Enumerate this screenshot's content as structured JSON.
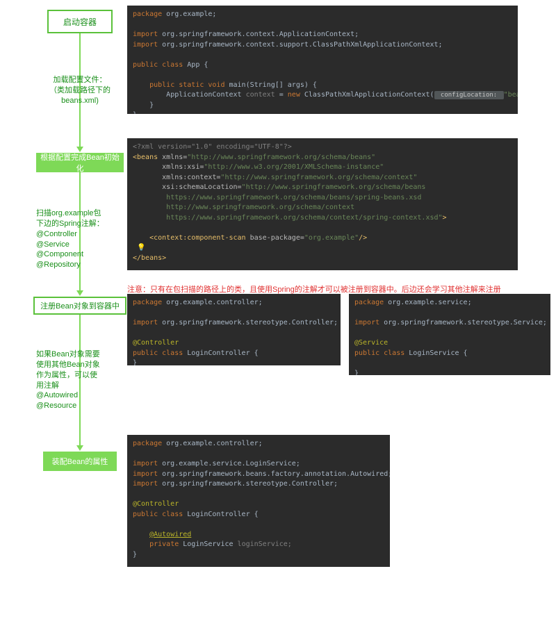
{
  "flow": {
    "box1": "启动容器",
    "box2": "根据配置完成Bean初始化",
    "box3": "注册Bean对象到容器中",
    "box4": "装配Bean的属性"
  },
  "notes": {
    "n1": "加载配置文件：\n（类加载路径下的\nbeans.xml)",
    "n2": "扫描org.example包\n下边的Spring注解：\n@Controller\n@Service\n@Component\n@Repository",
    "n3": "如果Bean对象需要\n使用其他Bean对象\n作为属性，可以使\n用注解\n@Autowired\n@Resource"
  },
  "warn": "注意：只有在包扫描的路径上的类，且使用Spring的注解才可以被注册到容器中。后边还会学习其他注解来注册",
  "code1": {
    "l1_pkg": "package",
    "l1_txt": " org.example;",
    "l3_imp": "import",
    "l3_txt": " org.springframework.context.ApplicationContext;",
    "l4_imp": "import",
    "l4_txt": " org.springframework.context.support.ClassPathXmlApplicationContext;",
    "l6a": "public class ",
    "l6b": "App {",
    "l8a": "public static void ",
    "l8b": "main(String[] args) {",
    "l9a": "ApplicationContext ",
    "l9var": "context",
    "l9b": " = ",
    "l9new": "new",
    "l9c": " ClassPathXmlApplicationContext(",
    "l9hint": " configLocation: ",
    "l9str": "\"beans.xml\"",
    "l9d": ");",
    "l10": "    }",
    "l11": "}"
  },
  "code2": {
    "l1": "<?xml version=\"1.0\" encoding=\"UTF-8\"?>",
    "l2a": "<beans",
    "l2b": " xmlns=",
    "l2s": "\"http://www.springframework.org/schema/beans\"",
    "l3a": "xmlns:xsi=",
    "l3s": "\"http://www.w3.org/2001/XMLSchema-instance\"",
    "l4a": "xmlns:context=",
    "l4s": "\"http://www.springframework.org/schema/context\"",
    "l5a": "xsi:schemaLocation=",
    "l5s": "\"http://www.springframework.org/schema/beans",
    "l6": "https://www.springframework.org/schema/beans/spring-beans.xsd",
    "l7": "http://www.springframework.org/schema/context",
    "l8": "https://www.springframework.org/schema/context/spring-context.xsd\"",
    "l8b": ">",
    "l10a": "<context:component-scan",
    "l10b": " base-package=",
    "l10s": "\"org.example\"",
    "l10c": "/>",
    "bulb": "💡",
    "l12": "</beans>"
  },
  "code3": {
    "l1_pkg": "package",
    "l1_txt": " org.example.controller;",
    "l3_imp": "import",
    "l3_txt": " org.springframework.stereotype.Controller;",
    "l5": "@Controller",
    "l6a": "public class ",
    "l6b": "LoginController {",
    "l7": "}"
  },
  "code4": {
    "l1_pkg": "package",
    "l1_txt": " org.example.service;",
    "l3_imp": "import",
    "l3_txt": " org.springframework.stereotype.Service;",
    "l5": "@Service",
    "l6a": "public class ",
    "l6b": "LoginService {",
    "l8": "}"
  },
  "code5": {
    "l1_pkg": "package",
    "l1_txt": " org.example.controller;",
    "l3_imp": "import",
    "l3_txt": " org.example.service.LoginService;",
    "l4_imp": "import",
    "l4_txt": " org.springframework.beans.factory.annotation.Autowired;",
    "l5_imp": "import",
    "l5_txt": " org.springframework.stereotype.Controller;",
    "l7": "@Controller",
    "l8a": "public class ",
    "l8b": "LoginController {",
    "l10": "@Autowired",
    "l11a": "private ",
    "l11b": "LoginService ",
    "l11c": "loginService;",
    "l12": "}"
  }
}
